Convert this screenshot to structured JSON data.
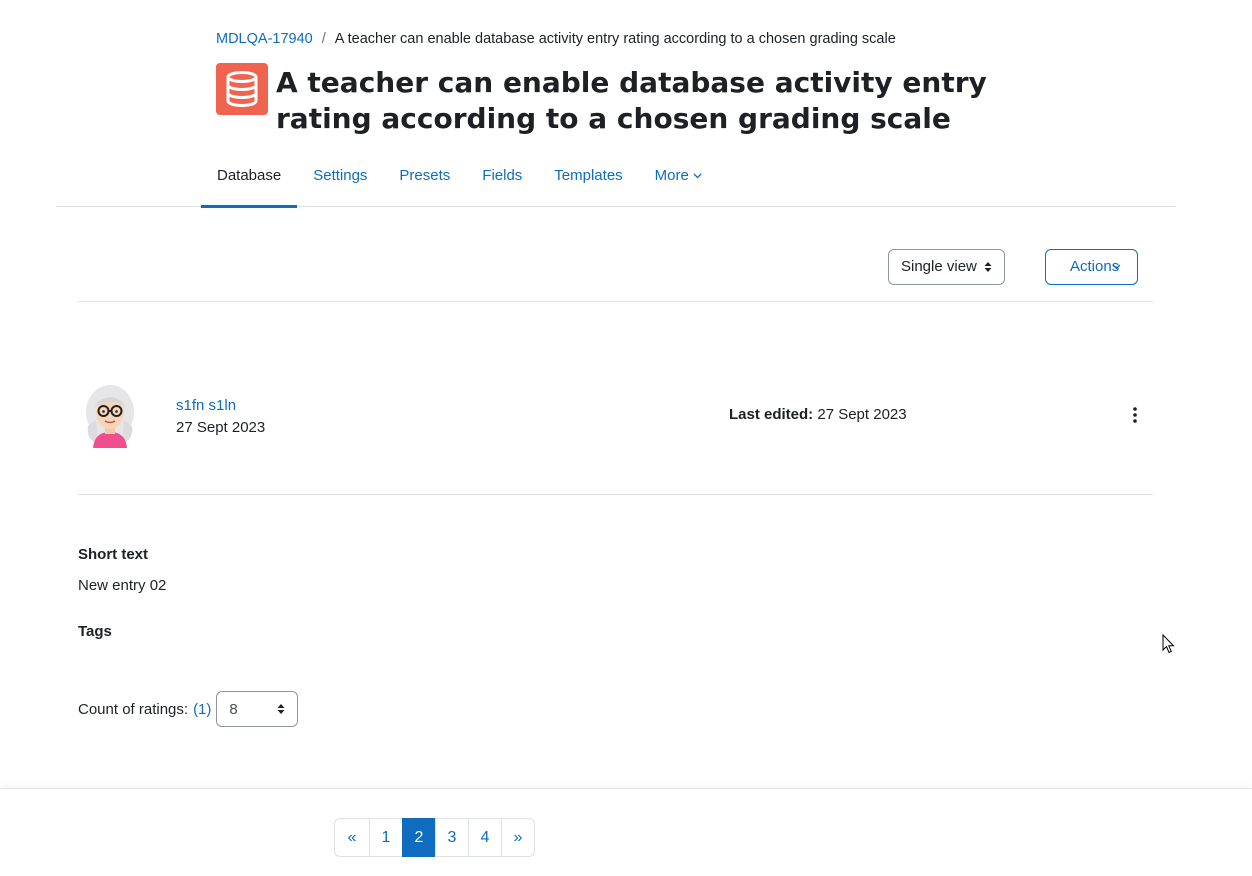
{
  "breadcrumb": {
    "course": "MDLQA-17940",
    "separator": "/",
    "current": "A teacher can enable database activity entry rating according to a chosen grading scale"
  },
  "header": {
    "icon": "database-icon",
    "icon_color": "#f0634e",
    "title": "A teacher can enable database activity entry rating according to a chosen grading scale"
  },
  "tabs": [
    {
      "label": "Database",
      "active": true
    },
    {
      "label": "Settings"
    },
    {
      "label": "Presets"
    },
    {
      "label": "Fields"
    },
    {
      "label": "Templates"
    },
    {
      "label": "More"
    }
  ],
  "toolbar": {
    "view_select": "Single view",
    "actions_label": "Actions"
  },
  "entry": {
    "user_name": "s1fn s1ln",
    "date": "27 Sept 2023",
    "last_edited_label": "Last edited:",
    "last_edited_value": "27 Sept 2023",
    "fields": [
      {
        "label": "Short text",
        "value": "New entry 02"
      },
      {
        "label": "Tags",
        "value": ""
      }
    ],
    "ratings": {
      "label": "Count of ratings:",
      "count_link": "(1)",
      "selected": "8"
    }
  },
  "pagination": {
    "prev": "«",
    "pages": [
      "1",
      "2",
      "3",
      "4"
    ],
    "current": "2",
    "next": "»"
  },
  "colors": {
    "primary": "#0f6cbf",
    "text": "#1d2125",
    "border": "#dee2e6"
  }
}
